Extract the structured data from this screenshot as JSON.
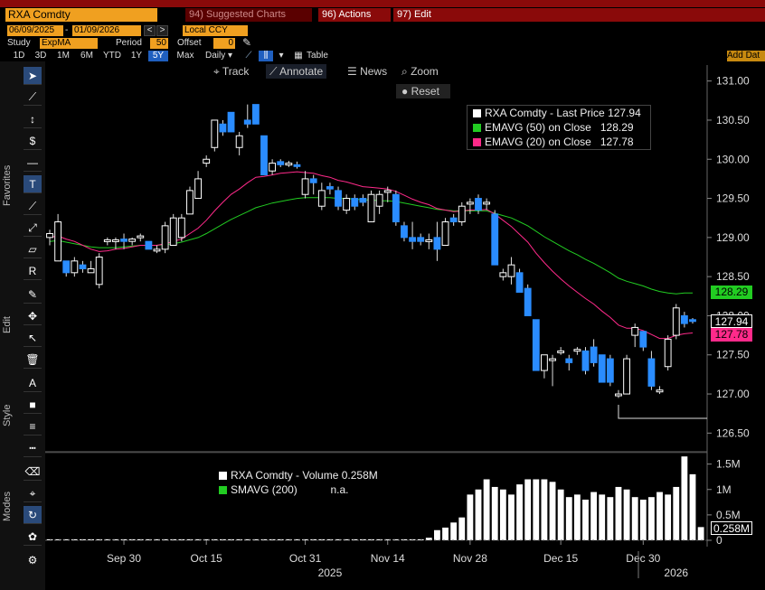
{
  "topbar": {
    "ticker": "RXA Comdty",
    "suggested": "94) Suggested Charts",
    "actions": "96) Actions",
    "edit": "97) Edit"
  },
  "controls": {
    "date_start": "06/09/2025",
    "date_end": "01/09/2026",
    "currency": "Local CCY",
    "study_label": "Study",
    "study_value": "ExpMA",
    "period_label": "Period",
    "period_value": "50",
    "offset_label": "Offset",
    "offset_value": "0",
    "table_label": "Table",
    "add_data": "Add Dat",
    "ranges": [
      "1D",
      "3D",
      "1M",
      "6M",
      "YTD",
      "1Y",
      "5Y",
      "Max"
    ],
    "selected_range": "5Y",
    "frequency": "Daily"
  },
  "chart_toolbar": {
    "track": "Track",
    "annotate": "Annotate",
    "news": "News",
    "zoom": "Zoom",
    "reset": "Reset"
  },
  "sidebar": {
    "favorites": "Favorites",
    "edit": "Edit",
    "style": "Style",
    "modes": "Modes"
  },
  "price_legend": [
    {
      "label": "RXA Comdty - Last Price",
      "value": "127.94",
      "color": "#ffffff"
    },
    {
      "label": "EMAVG (50)  on Close",
      "value": "128.29",
      "color": "#22cc22"
    },
    {
      "label": "EMAVG (20)  on Close",
      "value": "127.78",
      "color": "#ff2a8a"
    }
  ],
  "volume_legend": [
    {
      "label": "RXA Comdty - Volume",
      "value": "0.258M",
      "color": "#ffffff"
    },
    {
      "label": "SMAVG (200)",
      "value": "n.a.",
      "color": "#22cc22"
    }
  ],
  "price_tags": {
    "ema50": "128.29",
    "last": "127.94",
    "ema20": "127.78",
    "volume": "0.258M"
  },
  "chart_data": {
    "type": "candlestick",
    "y_ticks": [
      "131.00",
      "130.50",
      "130.00",
      "129.50",
      "129.00",
      "128.50",
      "128.00",
      "127.50",
      "127.00",
      "126.50"
    ],
    "ylim": [
      126.4,
      131.1
    ],
    "volume_ticks": [
      "1.5M",
      "1M",
      "0.5M",
      "0"
    ],
    "volume_ylim": [
      0,
      1.6
    ],
    "x_ticks": [
      "Sep 30",
      "Oct 15",
      "Oct 31",
      "Nov 14",
      "Nov 28",
      "Dec 15",
      "Dec 30"
    ],
    "x_tick_index": [
      9,
      19,
      31,
      41,
      51,
      62,
      72
    ],
    "year_labels": [
      {
        "label": "2025",
        "index": 34
      },
      {
        "label": "2026",
        "index": 76
      }
    ],
    "candles": [
      {
        "o": 129.0,
        "h": 129.1,
        "l": 128.9,
        "c": 129.05
      },
      {
        "o": 128.7,
        "h": 129.3,
        "l": 128.7,
        "c": 129.2
      },
      {
        "o": 128.7,
        "h": 128.7,
        "l": 128.5,
        "c": 128.55
      },
      {
        "o": 128.55,
        "h": 128.75,
        "l": 128.5,
        "c": 128.7
      },
      {
        "o": 128.65,
        "h": 128.7,
        "l": 128.55,
        "c": 128.6
      },
      {
        "o": 128.55,
        "h": 128.7,
        "l": 128.55,
        "c": 128.6
      },
      {
        "o": 128.4,
        "h": 128.8,
        "l": 128.35,
        "c": 128.75
      },
      {
        "o": 128.95,
        "h": 129.0,
        "l": 128.9,
        "c": 128.97
      },
      {
        "o": 128.95,
        "h": 129.0,
        "l": 128.85,
        "c": 128.97
      },
      {
        "o": 128.98,
        "h": 129.05,
        "l": 128.85,
        "c": 128.95
      },
      {
        "o": 128.95,
        "h": 129.0,
        "l": 128.9,
        "c": 128.98
      },
      {
        "o": 129.0,
        "h": 129.05,
        "l": 128.95,
        "c": 129.02
      },
      {
        "o": 128.95,
        "h": 128.95,
        "l": 128.85,
        "c": 128.85
      },
      {
        "o": 128.85,
        "h": 128.9,
        "l": 128.8,
        "c": 128.85
      },
      {
        "o": 128.85,
        "h": 129.2,
        "l": 128.8,
        "c": 129.15
      },
      {
        "o": 128.9,
        "h": 129.3,
        "l": 128.9,
        "c": 129.25
      },
      {
        "o": 129.0,
        "h": 129.3,
        "l": 128.95,
        "c": 129.25
      },
      {
        "o": 129.3,
        "h": 129.65,
        "l": 129.3,
        "c": 129.6
      },
      {
        "o": 129.5,
        "h": 129.85,
        "l": 129.5,
        "c": 129.75
      },
      {
        "o": 129.95,
        "h": 130.05,
        "l": 129.9,
        "c": 130.0
      },
      {
        "o": 130.15,
        "h": 130.5,
        "l": 130.1,
        "c": 130.5
      },
      {
        "o": 130.45,
        "h": 130.5,
        "l": 130.3,
        "c": 130.35
      },
      {
        "o": 130.6,
        "h": 130.6,
        "l": 130.35,
        "c": 130.35
      },
      {
        "o": 130.15,
        "h": 130.35,
        "l": 130.05,
        "c": 130.3
      },
      {
        "o": 130.5,
        "h": 130.7,
        "l": 130.4,
        "c": 130.45
      },
      {
        "o": 130.7,
        "h": 130.7,
        "l": 130.45,
        "c": 130.45
      },
      {
        "o": 130.3,
        "h": 130.3,
        "l": 129.8,
        "c": 129.8
      },
      {
        "o": 129.85,
        "h": 130.0,
        "l": 129.8,
        "c": 129.95
      },
      {
        "o": 129.97,
        "h": 130.0,
        "l": 129.9,
        "c": 129.93
      },
      {
        "o": 129.95,
        "h": 129.98,
        "l": 129.9,
        "c": 129.95
      },
      {
        "o": 129.93,
        "h": 129.97,
        "l": 129.88,
        "c": 129.92
      },
      {
        "o": 129.55,
        "h": 129.85,
        "l": 129.5,
        "c": 129.75
      },
      {
        "o": 129.75,
        "h": 129.8,
        "l": 129.55,
        "c": 129.7
      },
      {
        "o": 129.4,
        "h": 129.7,
        "l": 129.35,
        "c": 129.6
      },
      {
        "o": 129.65,
        "h": 129.7,
        "l": 129.55,
        "c": 129.62
      },
      {
        "o": 129.6,
        "h": 129.65,
        "l": 129.35,
        "c": 129.4
      },
      {
        "o": 129.35,
        "h": 129.55,
        "l": 129.3,
        "c": 129.5
      },
      {
        "o": 129.5,
        "h": 129.55,
        "l": 129.35,
        "c": 129.4
      },
      {
        "o": 129.5,
        "h": 129.55,
        "l": 129.4,
        "c": 129.45
      },
      {
        "o": 129.2,
        "h": 129.6,
        "l": 129.2,
        "c": 129.55
      },
      {
        "o": 129.4,
        "h": 129.6,
        "l": 129.3,
        "c": 129.55
      },
      {
        "o": 129.6,
        "h": 129.65,
        "l": 129.45,
        "c": 129.6
      },
      {
        "o": 129.55,
        "h": 129.6,
        "l": 129.15,
        "c": 129.2
      },
      {
        "o": 129.15,
        "h": 129.2,
        "l": 128.95,
        "c": 129.0
      },
      {
        "o": 129.0,
        "h": 129.2,
        "l": 128.85,
        "c": 128.95
      },
      {
        "o": 129.0,
        "h": 129.05,
        "l": 128.9,
        "c": 128.95
      },
      {
        "o": 128.95,
        "h": 129.05,
        "l": 128.85,
        "c": 128.97
      },
      {
        "o": 129.0,
        "h": 129.2,
        "l": 128.7,
        "c": 128.85
      },
      {
        "o": 128.9,
        "h": 129.25,
        "l": 128.9,
        "c": 129.2
      },
      {
        "o": 129.25,
        "h": 129.3,
        "l": 129.15,
        "c": 129.2
      },
      {
        "o": 129.2,
        "h": 129.45,
        "l": 129.15,
        "c": 129.4
      },
      {
        "o": 129.45,
        "h": 129.5,
        "l": 129.3,
        "c": 129.45
      },
      {
        "o": 129.5,
        "h": 129.55,
        "l": 129.3,
        "c": 129.35
      },
      {
        "o": 129.45,
        "h": 129.5,
        "l": 129.35,
        "c": 129.45
      },
      {
        "o": 129.3,
        "h": 129.35,
        "l": 128.65,
        "c": 128.65
      },
      {
        "o": 128.5,
        "h": 128.6,
        "l": 128.45,
        "c": 128.55
      },
      {
        "o": 128.5,
        "h": 128.75,
        "l": 128.4,
        "c": 128.65
      },
      {
        "o": 128.55,
        "h": 128.6,
        "l": 128.3,
        "c": 128.3
      },
      {
        "o": 128.35,
        "h": 128.4,
        "l": 128.0,
        "c": 128.0
      },
      {
        "o": 127.95,
        "h": 127.95,
        "l": 127.3,
        "c": 127.3
      },
      {
        "o": 127.3,
        "h": 127.5,
        "l": 127.2,
        "c": 127.5
      },
      {
        "o": 127.45,
        "h": 127.5,
        "l": 127.1,
        "c": 127.45
      },
      {
        "o": 127.55,
        "h": 127.6,
        "l": 127.5,
        "c": 127.55
      },
      {
        "o": 127.45,
        "h": 127.5,
        "l": 127.3,
        "c": 127.4
      },
      {
        "o": 127.55,
        "h": 127.6,
        "l": 127.5,
        "c": 127.57
      },
      {
        "o": 127.55,
        "h": 127.6,
        "l": 127.25,
        "c": 127.3
      },
      {
        "o": 127.6,
        "h": 127.7,
        "l": 127.35,
        "c": 127.4
      },
      {
        "o": 127.5,
        "h": 127.5,
        "l": 127.15,
        "c": 127.15
      },
      {
        "o": 127.45,
        "h": 127.5,
        "l": 127.1,
        "c": 127.15
      },
      {
        "o": 127.0,
        "h": 127.05,
        "l": 126.95,
        "c": 127.0
      },
      {
        "o": 127.0,
        "h": 127.5,
        "l": 127.0,
        "c": 127.45
      },
      {
        "o": 127.75,
        "h": 127.9,
        "l": 127.6,
        "c": 127.85
      },
      {
        "o": 127.8,
        "h": 127.8,
        "l": 127.55,
        "c": 127.6
      },
      {
        "o": 127.45,
        "h": 127.55,
        "l": 127.05,
        "c": 127.1
      },
      {
        "o": 127.05,
        "h": 127.1,
        "l": 127.0,
        "c": 127.05
      },
      {
        "o": 127.35,
        "h": 127.75,
        "l": 127.3,
        "c": 127.7
      },
      {
        "o": 127.75,
        "h": 128.15,
        "l": 127.7,
        "c": 128.1
      },
      {
        "o": 128.0,
        "h": 128.05,
        "l": 127.85,
        "c": 127.9
      },
      {
        "o": 127.95,
        "h": 127.97,
        "l": 127.9,
        "c": 127.94
      }
    ],
    "ema20": [
      129.0,
      129.02,
      128.98,
      128.95,
      128.9,
      128.85,
      128.82,
      128.83,
      128.85,
      128.86,
      128.88,
      128.9,
      128.9,
      128.9,
      128.92,
      128.95,
      128.98,
      129.05,
      129.12,
      129.22,
      129.34,
      129.45,
      129.55,
      129.62,
      129.7,
      129.77,
      129.78,
      129.8,
      129.82,
      129.83,
      129.84,
      129.83,
      129.82,
      129.79,
      129.77,
      129.73,
      129.71,
      129.68,
      129.65,
      129.64,
      129.63,
      129.62,
      129.59,
      129.54,
      129.49,
      129.45,
      129.42,
      129.37,
      129.35,
      129.33,
      129.34,
      129.35,
      129.35,
      129.36,
      129.3,
      129.22,
      129.14,
      129.04,
      128.94,
      128.8,
      128.68,
      128.57,
      128.47,
      128.38,
      128.3,
      128.22,
      128.15,
      128.06,
      127.98,
      127.88,
      127.84,
      127.84,
      127.81,
      127.76,
      127.71,
      127.71,
      127.75,
      127.77,
      127.78
    ],
    "ema50": [
      128.95,
      128.96,
      128.94,
      128.92,
      128.9,
      128.88,
      128.87,
      128.87,
      128.87,
      128.88,
      128.89,
      128.9,
      128.9,
      128.9,
      128.91,
      128.92,
      128.94,
      128.97,
      129.0,
      129.05,
      129.11,
      129.17,
      129.23,
      129.28,
      129.33,
      129.38,
      129.41,
      129.44,
      129.46,
      129.48,
      129.5,
      129.51,
      129.51,
      129.51,
      129.51,
      129.5,
      129.5,
      129.49,
      129.48,
      129.48,
      129.47,
      129.47,
      129.46,
      129.44,
      129.42,
      129.4,
      129.38,
      129.36,
      129.35,
      129.34,
      129.34,
      129.34,
      129.34,
      129.34,
      129.31,
      129.28,
      129.25,
      129.2,
      129.15,
      129.08,
      129.01,
      128.95,
      128.89,
      128.83,
      128.78,
      128.72,
      128.67,
      128.61,
      128.55,
      128.48,
      128.44,
      128.41,
      128.38,
      128.34,
      128.31,
      128.29,
      128.28,
      128.29,
      128.29
    ],
    "volume": [
      0.02,
      0.02,
      0.02,
      0.02,
      0.02,
      0.02,
      0.02,
      0.02,
      0.02,
      0.02,
      0.02,
      0.02,
      0.02,
      0.02,
      0.02,
      0.02,
      0.02,
      0.02,
      0.02,
      0.02,
      0.02,
      0.02,
      0.02,
      0.02,
      0.02,
      0.02,
      0.02,
      0.02,
      0.02,
      0.02,
      0.02,
      0.02,
      0.02,
      0.02,
      0.02,
      0.02,
      0.02,
      0.02,
      0.02,
      0.02,
      0.02,
      0.02,
      0.02,
      0.02,
      0.02,
      0.02,
      0.05,
      0.2,
      0.25,
      0.35,
      0.45,
      0.9,
      1.0,
      1.2,
      1.05,
      1.0,
      0.9,
      1.1,
      1.2,
      1.2,
      1.2,
      1.15,
      1.0,
      0.85,
      0.9,
      0.8,
      0.95,
      0.9,
      0.85,
      1.05,
      1.0,
      0.85,
      0.8,
      0.85,
      0.95,
      0.9,
      1.05,
      1.65,
      1.3,
      0.26
    ]
  }
}
